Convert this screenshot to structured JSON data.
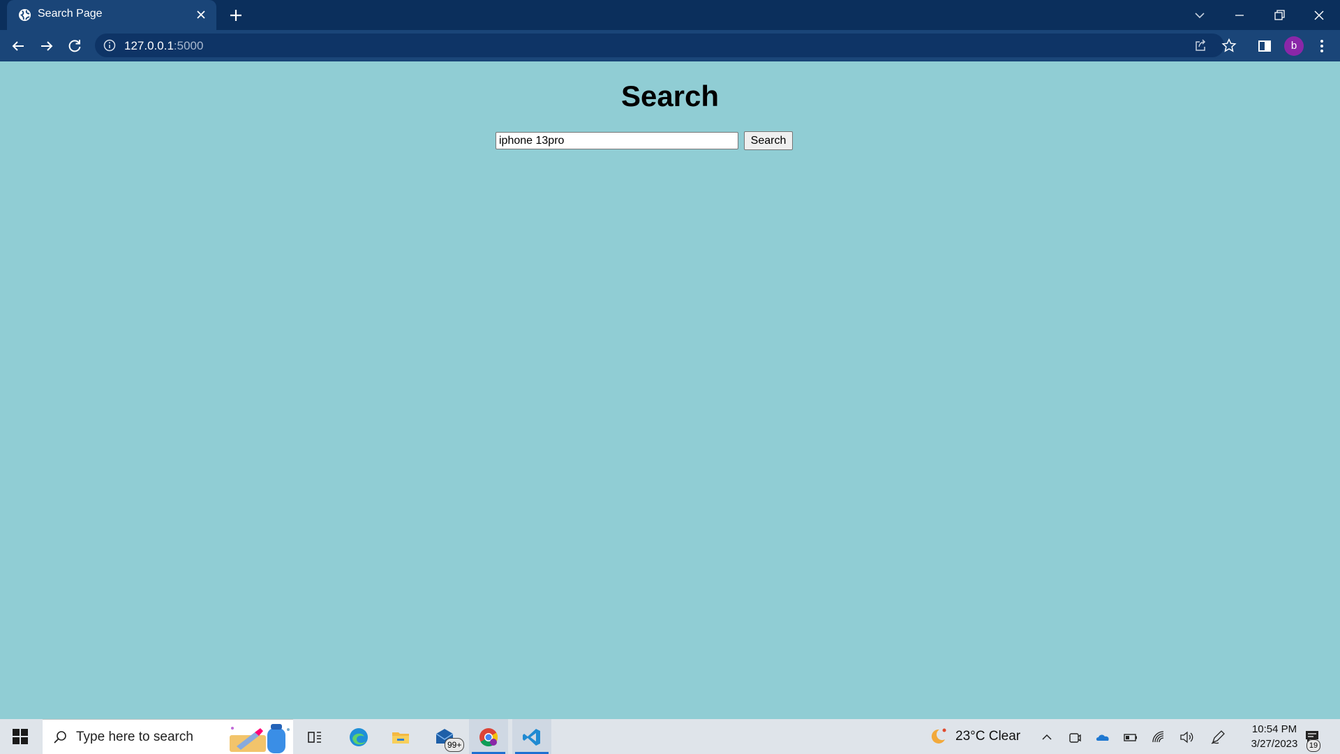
{
  "browser": {
    "tab_title": "Search Page",
    "url_host": "127.0.0.1",
    "url_port": ":5000",
    "profile_initial": "b",
    "icons": [
      "globe-icon",
      "close-icon",
      "plus-icon",
      "chevron-down-icon",
      "minimize-icon",
      "restore-icon",
      "close-icon",
      "back-arrow-icon",
      "forward-arrow-icon",
      "reload-icon",
      "info-icon",
      "share-icon",
      "star-icon",
      "sidepanel-icon",
      "kebab-menu-icon"
    ],
    "colors": {
      "titlebar": "#0b2f5c",
      "toolbar": "#1a4578",
      "avatar": "#8a27a8"
    }
  },
  "page": {
    "heading": "Search",
    "search_value": "iphone 13pro",
    "search_button": "Search",
    "background": "#90cdd4"
  },
  "taskbar": {
    "search_placeholder": "Type here to search",
    "mail_badge": "99+",
    "weather": "23°C  Clear",
    "time": "10:54 PM",
    "date": "3/27/2023",
    "notification_count": "19"
  }
}
